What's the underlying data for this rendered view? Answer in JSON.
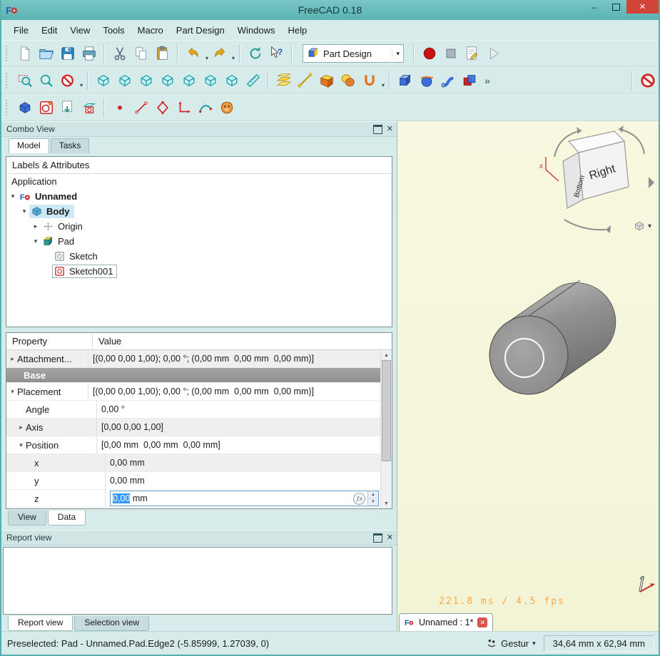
{
  "window": {
    "title": "FreeCAD 0.18"
  },
  "colors": {
    "titlebar": "#5ab2b2",
    "window_bg": "#d8ebeb",
    "viewport_bg": "#f6f7dc",
    "tree_selection": "#cbe8f6",
    "group_row": "#9b9b9b",
    "fps_text": "#ffa640",
    "close_button": "#cf4437",
    "edit_selection": "#3399ff"
  },
  "menu": {
    "items": [
      "File",
      "Edit",
      "View",
      "Tools",
      "Macro",
      "Part Design",
      "Windows",
      "Help"
    ]
  },
  "toolbars": {
    "workbench_label": "Part Design",
    "row1": [
      {
        "name": "new-document",
        "kind": "file"
      },
      {
        "name": "open-document",
        "kind": "folder"
      },
      {
        "name": "save-document",
        "kind": "save"
      },
      {
        "name": "print",
        "kind": "print"
      },
      {
        "kind": "sep"
      },
      {
        "name": "cut",
        "kind": "cut"
      },
      {
        "name": "copy",
        "kind": "copy"
      },
      {
        "name": "paste",
        "kind": "paste"
      },
      {
        "kind": "sep"
      },
      {
        "name": "undo",
        "kind": "undo",
        "dd": true
      },
      {
        "name": "redo",
        "kind": "redo",
        "dd": true
      },
      {
        "kind": "sep"
      },
      {
        "name": "refresh",
        "kind": "refresh"
      },
      {
        "name": "whats-this",
        "kind": "helpcursor"
      },
      {
        "kind": "sep"
      },
      {
        "kind": "combo"
      },
      {
        "kind": "sep"
      },
      {
        "name": "macro-record",
        "kind": "record"
      },
      {
        "name": "macro-stop",
        "kind": "stop"
      },
      {
        "name": "macro-edit",
        "kind": "macroedit"
      },
      {
        "name": "macro-execute",
        "kind": "play"
      }
    ],
    "row2": [
      {
        "name": "fit-all",
        "kind": "zoomfit"
      },
      {
        "name": "fit-selection",
        "kind": "zoom"
      },
      {
        "name": "draw-style",
        "kind": "drawstyle",
        "dd": true
      },
      {
        "kind": "sep"
      },
      {
        "name": "view-isometric",
        "kind": "cube"
      },
      {
        "name": "view-front",
        "kind": "cube"
      },
      {
        "name": "view-top",
        "kind": "cube"
      },
      {
        "name": "view-right",
        "kind": "cube"
      },
      {
        "name": "view-rear",
        "kind": "cube"
      },
      {
        "name": "view-bottom",
        "kind": "cube"
      },
      {
        "name": "view-left",
        "kind": "cube"
      },
      {
        "name": "measure-distance",
        "kind": "ruler"
      },
      {
        "kind": "sep"
      },
      {
        "name": "datum-plane",
        "kind": "datumplane"
      },
      {
        "name": "datum-line",
        "kind": "datumline"
      },
      {
        "name": "shape-binder",
        "kind": "shapebinder"
      },
      {
        "name": "clone",
        "kind": "clone"
      },
      {
        "name": "datum-tools",
        "kind": "datummore",
        "dd": true
      },
      {
        "kind": "sep"
      },
      {
        "name": "pad",
        "kind": "pad"
      },
      {
        "name": "revolution",
        "kind": "revolve"
      },
      {
        "name": "additive-pipe",
        "kind": "pipe"
      },
      {
        "name": "boolean-operation",
        "kind": "boolean"
      },
      {
        "kind": "overflow"
      },
      {
        "kind": "sep",
        "push": true
      },
      {
        "name": "toggle-active-body",
        "kind": "noentry"
      }
    ],
    "row3": [
      {
        "name": "create-body",
        "kind": "body"
      },
      {
        "name": "create-sketch",
        "kind": "sketchnew"
      },
      {
        "name": "edit-sketch",
        "kind": "sketchimport"
      },
      {
        "name": "map-sketch",
        "kind": "sketchmap"
      },
      {
        "kind": "sep"
      },
      {
        "name": "sketch-point",
        "kind": "point"
      },
      {
        "name": "sketch-line",
        "kind": "line"
      },
      {
        "name": "sketch-polyline",
        "kind": "polyline"
      },
      {
        "name": "external-geometry",
        "kind": "axes"
      },
      {
        "name": "sketch-bspline",
        "kind": "bspline"
      },
      {
        "name": "carbon-copy",
        "kind": "face"
      }
    ]
  },
  "combo_view": {
    "title": "Combo View",
    "tabs": [
      {
        "label": "Model",
        "active": true
      },
      {
        "label": "Tasks",
        "active": false
      }
    ],
    "tree": {
      "header": "Labels & Attributes",
      "root": "Application",
      "items": [
        {
          "label": "Unnamed",
          "depth": 1,
          "icon": "treedoc",
          "icon_name": "document-icon",
          "bold": true,
          "expander": "open"
        },
        {
          "label": "Body",
          "depth": 2,
          "icon": "treebody",
          "icon_name": "body-icon",
          "bold": true,
          "selected": true,
          "expander": "open"
        },
        {
          "label": "Origin",
          "depth": 3,
          "icon": "treeorigin",
          "icon_name": "origin-icon",
          "expander": "closed"
        },
        {
          "label": "Pad",
          "depth": 3,
          "icon": "treepad",
          "icon_name": "pad-icon",
          "expander": "open"
        },
        {
          "label": "Sketch",
          "depth": 4,
          "icon": "treesketchg",
          "icon_name": "sketch-icon"
        },
        {
          "label": "Sketch001",
          "depth": 4,
          "icon": "treesketch",
          "icon_name": "sketch-icon",
          "focused": true
        }
      ]
    },
    "properties": {
      "columns": [
        "Property",
        "Value"
      ],
      "rows": [
        {
          "name": "Attachment...",
          "value": "[(0,00 0,00 1,00); 0,00 °; (0,00 mm  0,00 mm  0,00 mm)]",
          "expander": "closed",
          "depth": 0,
          "shaded": true
        },
        {
          "name": "Base",
          "group": true
        },
        {
          "name": "Placement",
          "value": "[(0,00 0,00 1,00); 0,00 °; (0,00 mm  0,00 mm  0,00 mm)]",
          "expander": "open",
          "depth": 0,
          "shaded": false
        },
        {
          "name": "Angle",
          "value": "0,00 °",
          "depth": 1,
          "shaded": false
        },
        {
          "name": "Axis",
          "value": "[0,00 0,00 1,00]",
          "expander": "closed",
          "depth": 1,
          "shaded": true
        },
        {
          "name": "Position",
          "value": "[0,00 mm  0,00 mm  0,00 mm]",
          "expander": "open",
          "depth": 1,
          "shaded": false
        },
        {
          "name": "x",
          "value": "0,00 mm",
          "depth": 2,
          "shaded": true
        },
        {
          "name": "y",
          "value": "0,00 mm",
          "depth": 2,
          "shaded": false
        },
        {
          "name": "z",
          "value": "0,00",
          "suffix": " mm",
          "editing": true,
          "depth": 2,
          "shaded": false
        }
      ]
    },
    "bottom_tabs": [
      {
        "label": "View",
        "active": false
      },
      {
        "label": "Data",
        "active": true
      }
    ]
  },
  "report_view": {
    "title": "Report view",
    "tabs": [
      {
        "label": "Report view",
        "active": true
      },
      {
        "label": "Selection view",
        "active": false
      }
    ]
  },
  "viewport": {
    "fps_text": "221.8 ms / 4.5 fps",
    "tab_label": "Unnamed : 1*",
    "nav_cube": {
      "faces": [
        "Right",
        "Bottom"
      ],
      "axis_labels": [
        "x"
      ]
    }
  },
  "status_bar": {
    "message": "Preselected: Pad - Unnamed.Pad.Edge2 (-5.85999, 1.27039, 0)",
    "nav_style_label": "Gestur",
    "dimensions": "34,64 mm x 62,94 mm"
  }
}
